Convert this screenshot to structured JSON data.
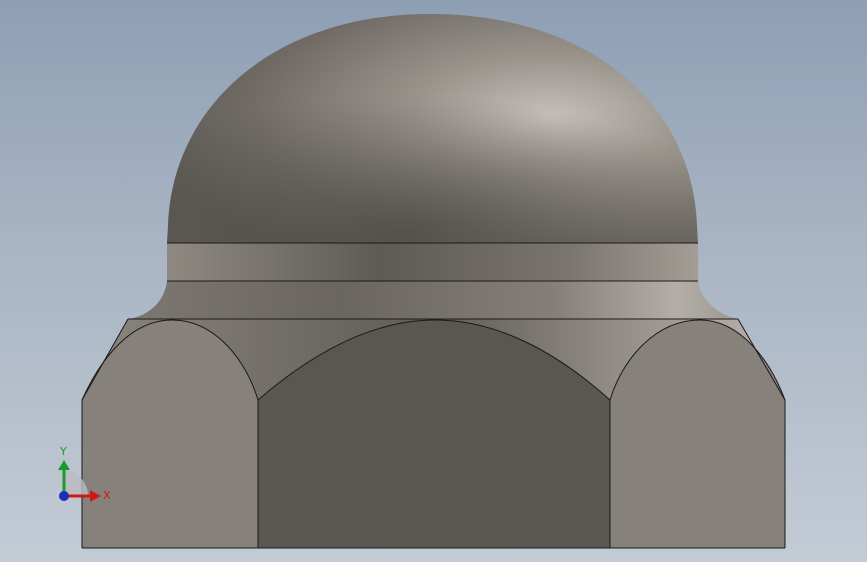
{
  "viewport": {
    "background_top": "#8e9fb4",
    "background_bottom": "#c3cbd5"
  },
  "model": {
    "name": "acorn-cap-nut",
    "colors": {
      "dome_light": "#c3bdb8",
      "dome_mid": "#8e8880",
      "dome_dark": "#5d5954",
      "hex_side_face": "#87817b",
      "hex_front_face": "#5a5752",
      "edge": "#1a1a1a"
    }
  },
  "view_triad": {
    "x_label": "X",
    "y_label": "Y",
    "x_color": "#d01818",
    "y_color": "#1c9a2a",
    "z_color": "#1a2fb8"
  }
}
